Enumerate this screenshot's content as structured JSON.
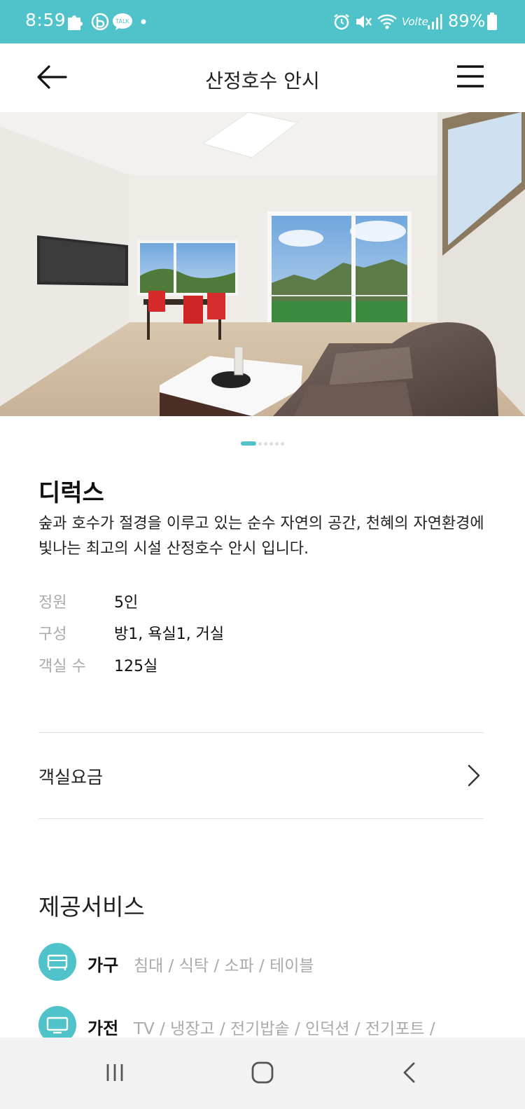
{
  "status_bar": {
    "time": "8:59",
    "battery": "89%",
    "icons": [
      "puzzle-icon",
      "b-app-icon",
      "talk-icon",
      "dot-icon",
      "alarm-icon",
      "mute-icon",
      "wifi-icon",
      "volte-icon",
      "signal-icon",
      "battery-icon"
    ],
    "talk_text": "TALK",
    "volte_text": "Volte"
  },
  "header": {
    "title": "산정호수 안시"
  },
  "hero": {
    "page_count": 6,
    "active_index": 0
  },
  "room": {
    "name": "디럭스",
    "description": "숲과 호수가 절경을 이루고 있는 순수 자연의 공간, 천혜의 자연환경에 빛나는 최고의 시설 산정호수 안시 입니다.",
    "specs": [
      {
        "label": "정원",
        "value": "5인"
      },
      {
        "label": "구성",
        "value": "방1, 욕실1, 거실"
      },
      {
        "label": "객실 수",
        "value": "125실"
      }
    ]
  },
  "rates": {
    "label": "객실요금"
  },
  "services": {
    "title": "제공서비스",
    "items": [
      {
        "category": "가구",
        "items": "침대 / 식탁 / 소파 / 테이블",
        "icon": "bed-icon"
      },
      {
        "category": "가전",
        "items": "TV / 냉장고 / 전기밥솥 / 인덕션 / 전기포트 /",
        "icon": "tv-icon"
      }
    ]
  },
  "colors": {
    "accent": "#4fc3c9",
    "status_bar": "#4fc3c9",
    "muted_text": "#aaaaaa",
    "nav_bar": "#f2f2f2"
  }
}
